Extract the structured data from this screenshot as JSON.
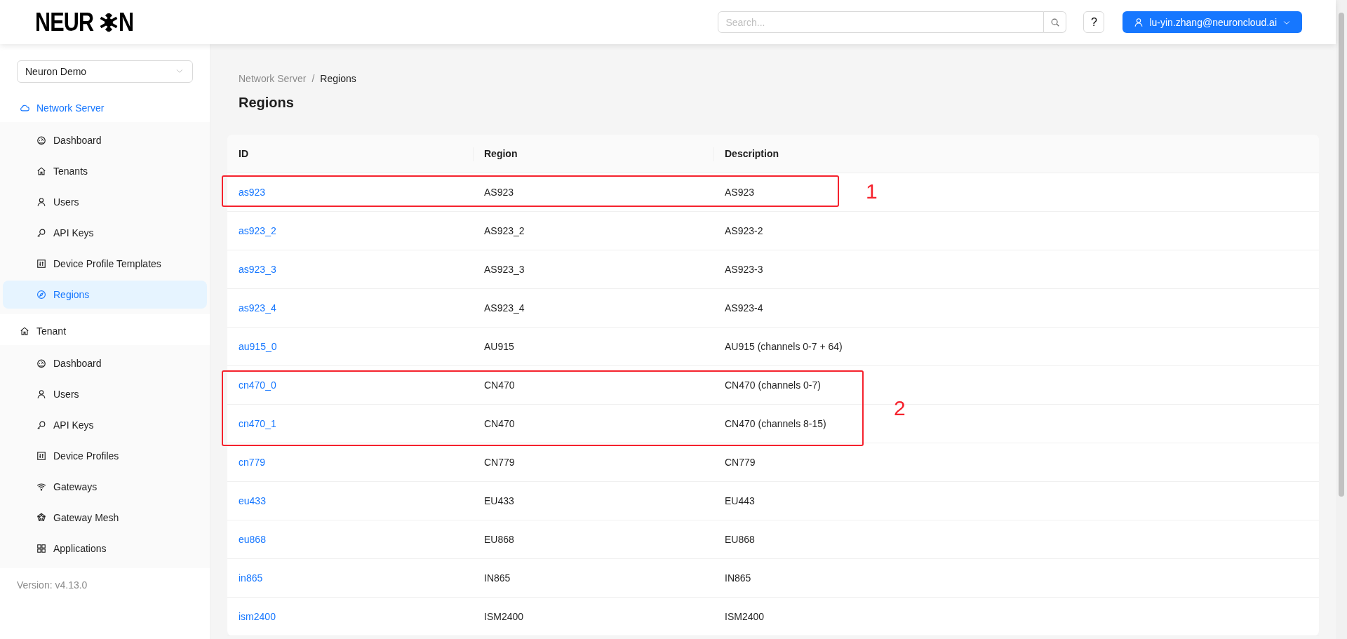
{
  "header": {
    "logo": {
      "left": "NEUR",
      "right": "N"
    },
    "search": {
      "placeholder": "Search..."
    },
    "help_button": "?",
    "user_menu": "lu-yin.zhang@neuroncloud.ai"
  },
  "sidebar": {
    "tenant_select": "Neuron Demo",
    "sections": [
      {
        "label": "Network Server",
        "selected": true,
        "items": [
          {
            "label": "Dashboard",
            "selected": false
          },
          {
            "label": "Tenants",
            "selected": false
          },
          {
            "label": "Users",
            "selected": false
          },
          {
            "label": "API Keys",
            "selected": false
          },
          {
            "label": "Device Profile Templates",
            "selected": false
          },
          {
            "label": "Regions",
            "selected": true
          }
        ]
      },
      {
        "label": "Tenant",
        "selected": false,
        "items": [
          {
            "label": "Dashboard",
            "selected": false
          },
          {
            "label": "Users",
            "selected": false
          },
          {
            "label": "API Keys",
            "selected": false
          },
          {
            "label": "Device Profiles",
            "selected": false
          },
          {
            "label": "Gateways",
            "selected": false
          },
          {
            "label": "Gateway Mesh",
            "selected": false
          },
          {
            "label": "Applications",
            "selected": false
          }
        ]
      }
    ],
    "version": "Version: v4.13.0"
  },
  "breadcrumb": {
    "items": [
      "Network Server",
      "Regions"
    ],
    "separator": "/"
  },
  "page_title": "Regions",
  "table": {
    "columns": [
      "ID",
      "Region",
      "Description"
    ],
    "rows": [
      [
        "as923",
        "AS923",
        "AS923"
      ],
      [
        "as923_2",
        "AS923_2",
        "AS923-2"
      ],
      [
        "as923_3",
        "AS923_3",
        "AS923-3"
      ],
      [
        "as923_4",
        "AS923_4",
        "AS923-4"
      ],
      [
        "au915_0",
        "AU915",
        "AU915 (channels 0-7 + 64)"
      ],
      [
        "cn470_0",
        "CN470",
        "CN470 (channels 0-7)"
      ],
      [
        "cn470_1",
        "CN470",
        "CN470 (channels 8-15)"
      ],
      [
        "cn779",
        "CN779",
        "CN779"
      ],
      [
        "eu433",
        "EU433",
        "EU443"
      ],
      [
        "eu868",
        "EU868",
        "EU868"
      ],
      [
        "in865",
        "IN865",
        "IN865"
      ],
      [
        "ism2400",
        "ISM2400",
        "ISM2400"
      ]
    ]
  },
  "annotations": [
    {
      "label": "1"
    },
    {
      "label": "2"
    }
  ]
}
